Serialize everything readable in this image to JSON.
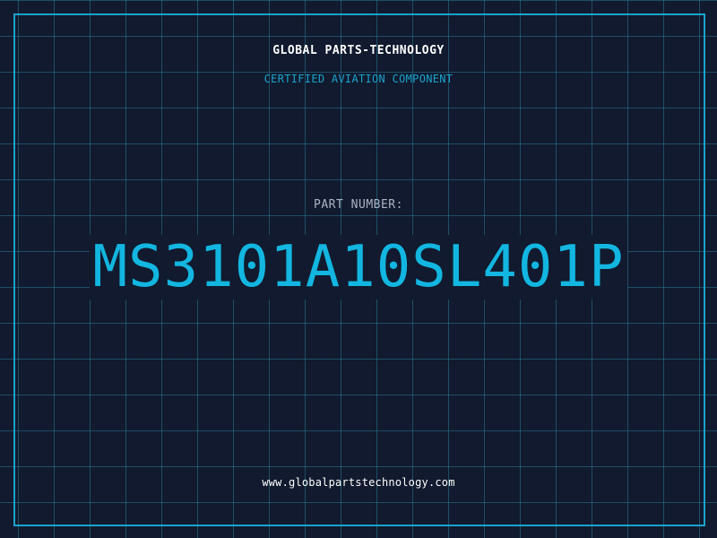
{
  "header": {
    "company": "GLOBAL PARTS-TECHNOLOGY",
    "subtitle": "CERTIFIED AVIATION COMPONENT"
  },
  "part": {
    "label": "PART NUMBER:",
    "number": "MS3101A10SL401P"
  },
  "footer": {
    "website": "www.globalpartstechnology.com"
  },
  "colors": {
    "background": "#111a2e",
    "grid": "#287896",
    "accent": "#12b6e0",
    "frame": "#1aa3cc",
    "label": "#aab4c4",
    "text": "#ffffff"
  }
}
